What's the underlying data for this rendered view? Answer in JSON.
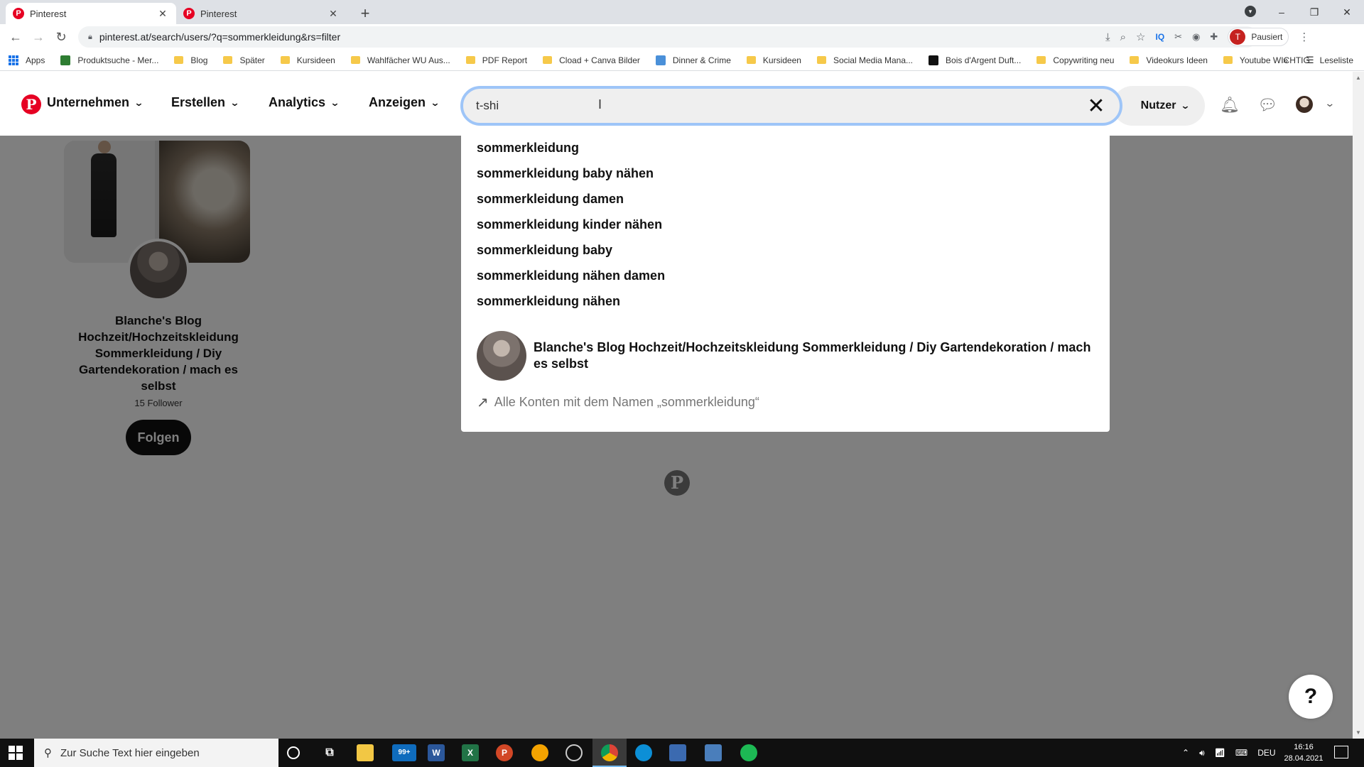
{
  "browser": {
    "tabs": [
      {
        "favicon": "P",
        "title": "Pinterest",
        "close": "✕"
      },
      {
        "favicon": "P",
        "title": "Pinterest",
        "close": "✕"
      }
    ],
    "new_tab": "+",
    "window_controls": {
      "minimize": "–",
      "restore": "❐",
      "close": "✕"
    },
    "url": "pinterest.at/search/users/?q=sommerkleidung&rs=filter",
    "profile_initial": "T",
    "profile_status": "Pausiert",
    "bookmarks": [
      {
        "label": "Apps",
        "icon": "apps-icon"
      },
      {
        "label": "Produktsuche - Mer...",
        "icon": "site-icon",
        "color": "#2e7d32"
      },
      {
        "label": "Blog",
        "icon": "folder-icon"
      },
      {
        "label": "Später",
        "icon": "folder-icon"
      },
      {
        "label": "Kursideen",
        "icon": "folder-icon"
      },
      {
        "label": "Wahlfächer WU Aus...",
        "icon": "folder-icon"
      },
      {
        "label": "PDF Report",
        "icon": "folder-icon"
      },
      {
        "label": "Cload + Canva Bilder",
        "icon": "folder-icon"
      },
      {
        "label": "Dinner & Crime",
        "icon": "site-icon",
        "color": "#4a90d9"
      },
      {
        "label": "Kursideen",
        "icon": "folder-icon"
      },
      {
        "label": "Social Media Mana...",
        "icon": "folder-icon"
      },
      {
        "label": "Bois d'Argent Duft...",
        "icon": "site-icon",
        "color": "#111111"
      },
      {
        "label": "Copywriting neu",
        "icon": "folder-icon"
      },
      {
        "label": "Videokurs Ideen",
        "icon": "folder-icon"
      },
      {
        "label": "Youtube WICHTIG",
        "icon": "folder-icon"
      }
    ],
    "bookmarks_more": "»",
    "reading_list": "Leseliste"
  },
  "pinterest": {
    "logo": "P",
    "nav": {
      "business": "Unternehmen",
      "create": "Erstellen",
      "analytics": "Analytics",
      "ads": "Anzeigen"
    },
    "search": {
      "value": "t-shi",
      "clear": "✕"
    },
    "filter_label": "Nutzer",
    "suggestions": [
      "sommerkleidung",
      "sommerkleidung baby nähen",
      "sommerkleidung damen",
      "sommerkleidung kinder nähen",
      "sommerkleidung baby",
      "sommerkleidung nähen damen",
      "sommerkleidung nähen"
    ],
    "account_suggestion": "Blanche's Blog Hochzeit/Hochzeitskleidung Sommerkleidung / Diy Gartendekoration / mach es selbst",
    "all_accounts_label": "Alle Konten mit dem Namen „sommerkleidung“",
    "profile_card": {
      "name": "Blanche's Blog Hochzeit/Hochzeitskleidung Sommerkleidung / Diy Gartendekoration / mach es selbst",
      "followers": "15 Follower",
      "follow_button": "Folgen"
    },
    "help": "?"
  },
  "taskbar": {
    "search_placeholder": "Zur Suche Text hier eingeben",
    "mail_badge": "99+",
    "language": "DEU",
    "time": "16:16",
    "date": "28.04.2021"
  },
  "colors": {
    "pinterest_red": "#e60023",
    "search_focus": "#9ec5f8",
    "overlay": "rgba(0,0,0,0.5)"
  }
}
